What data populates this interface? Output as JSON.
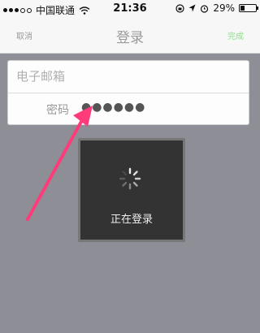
{
  "status_bar": {
    "carrier": "中国联通",
    "time": "21:36",
    "battery_percent": "29%",
    "battery_level": 0.29,
    "icons": [
      "signal-dots-icon",
      "wifi-icon",
      "rotation-lock-icon",
      "location-arrow-icon",
      "alarm-icon",
      "battery-icon"
    ]
  },
  "nav": {
    "cancel_label": "取消",
    "title": "登录",
    "done_label": "完成"
  },
  "form": {
    "email_placeholder": "电子邮箱",
    "email_value": "",
    "password_label": "密码",
    "password_value": "●●●●●●"
  },
  "loading": {
    "text": "正在登录"
  },
  "colors": {
    "done_green": "#8ee08a",
    "overlay_bg": "#333333",
    "backdrop": "#8e8e96",
    "arrow": "#ff3b7a"
  }
}
